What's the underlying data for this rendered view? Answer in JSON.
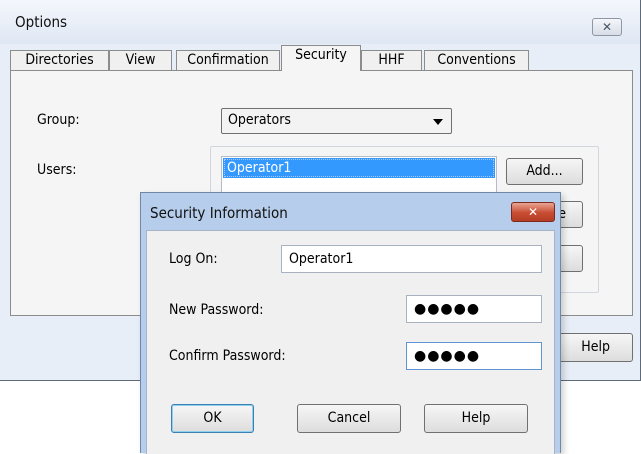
{
  "options_window": {
    "title": "Options",
    "close_glyph": "✕",
    "tabs": [
      "Directories",
      "View",
      "Confirmation",
      "Security",
      "HHF",
      "Conventions"
    ],
    "active_tab": "Security",
    "group_label": "Group:",
    "group_value": "Operators",
    "users_label": "Users:",
    "users": [
      "Operator1"
    ],
    "add_label": "Add...",
    "remove_partial": "e",
    "help_partial": "Help"
  },
  "security_dialog": {
    "title": "Security Information",
    "close_glyph": "✕",
    "logon_label": "Log On:",
    "logon_value": "Operator1",
    "new_password_label": "New Password:",
    "new_password_value": "●●●●●",
    "confirm_password_label": "Confirm Password:",
    "confirm_password_value": "●●●●●",
    "ok_label": "OK",
    "cancel_label": "Cancel",
    "help_label": "Help"
  },
  "colors": {
    "selection": "#3399ff",
    "dialog_frame": "#b6ceeb",
    "close_button_red": "#c74c32"
  }
}
